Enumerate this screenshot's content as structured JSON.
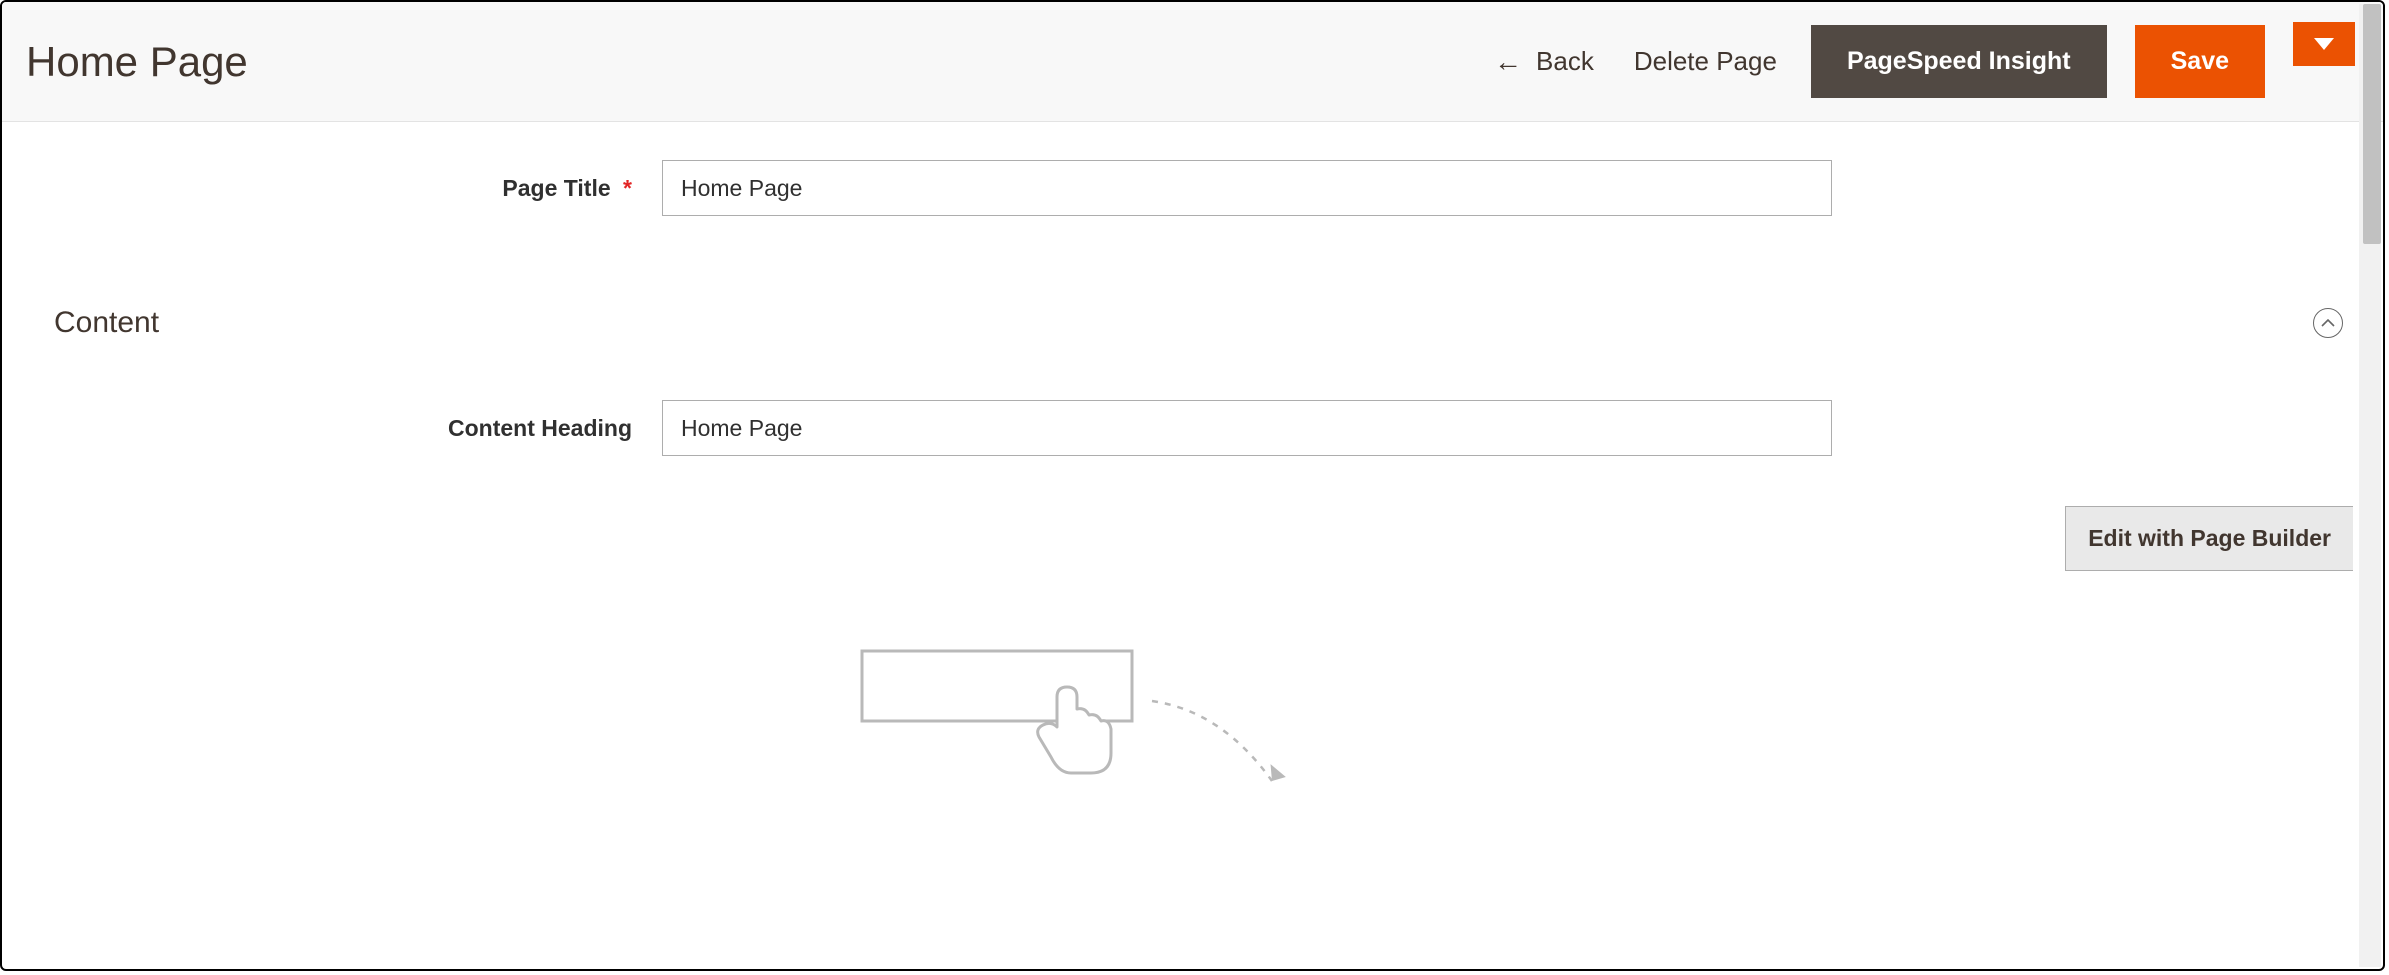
{
  "header": {
    "title": "Home Page",
    "back_label": "Back",
    "delete_label": "Delete Page",
    "pagespeed_label": "PageSpeed Insight",
    "save_label": "Save"
  },
  "fields": {
    "page_title": {
      "label": "Page Title",
      "value": "Home Page"
    },
    "content_heading": {
      "label": "Content Heading",
      "value": "Home Page"
    }
  },
  "section": {
    "content_label": "Content"
  },
  "builder": {
    "edit_label": "Edit with Page Builder"
  }
}
